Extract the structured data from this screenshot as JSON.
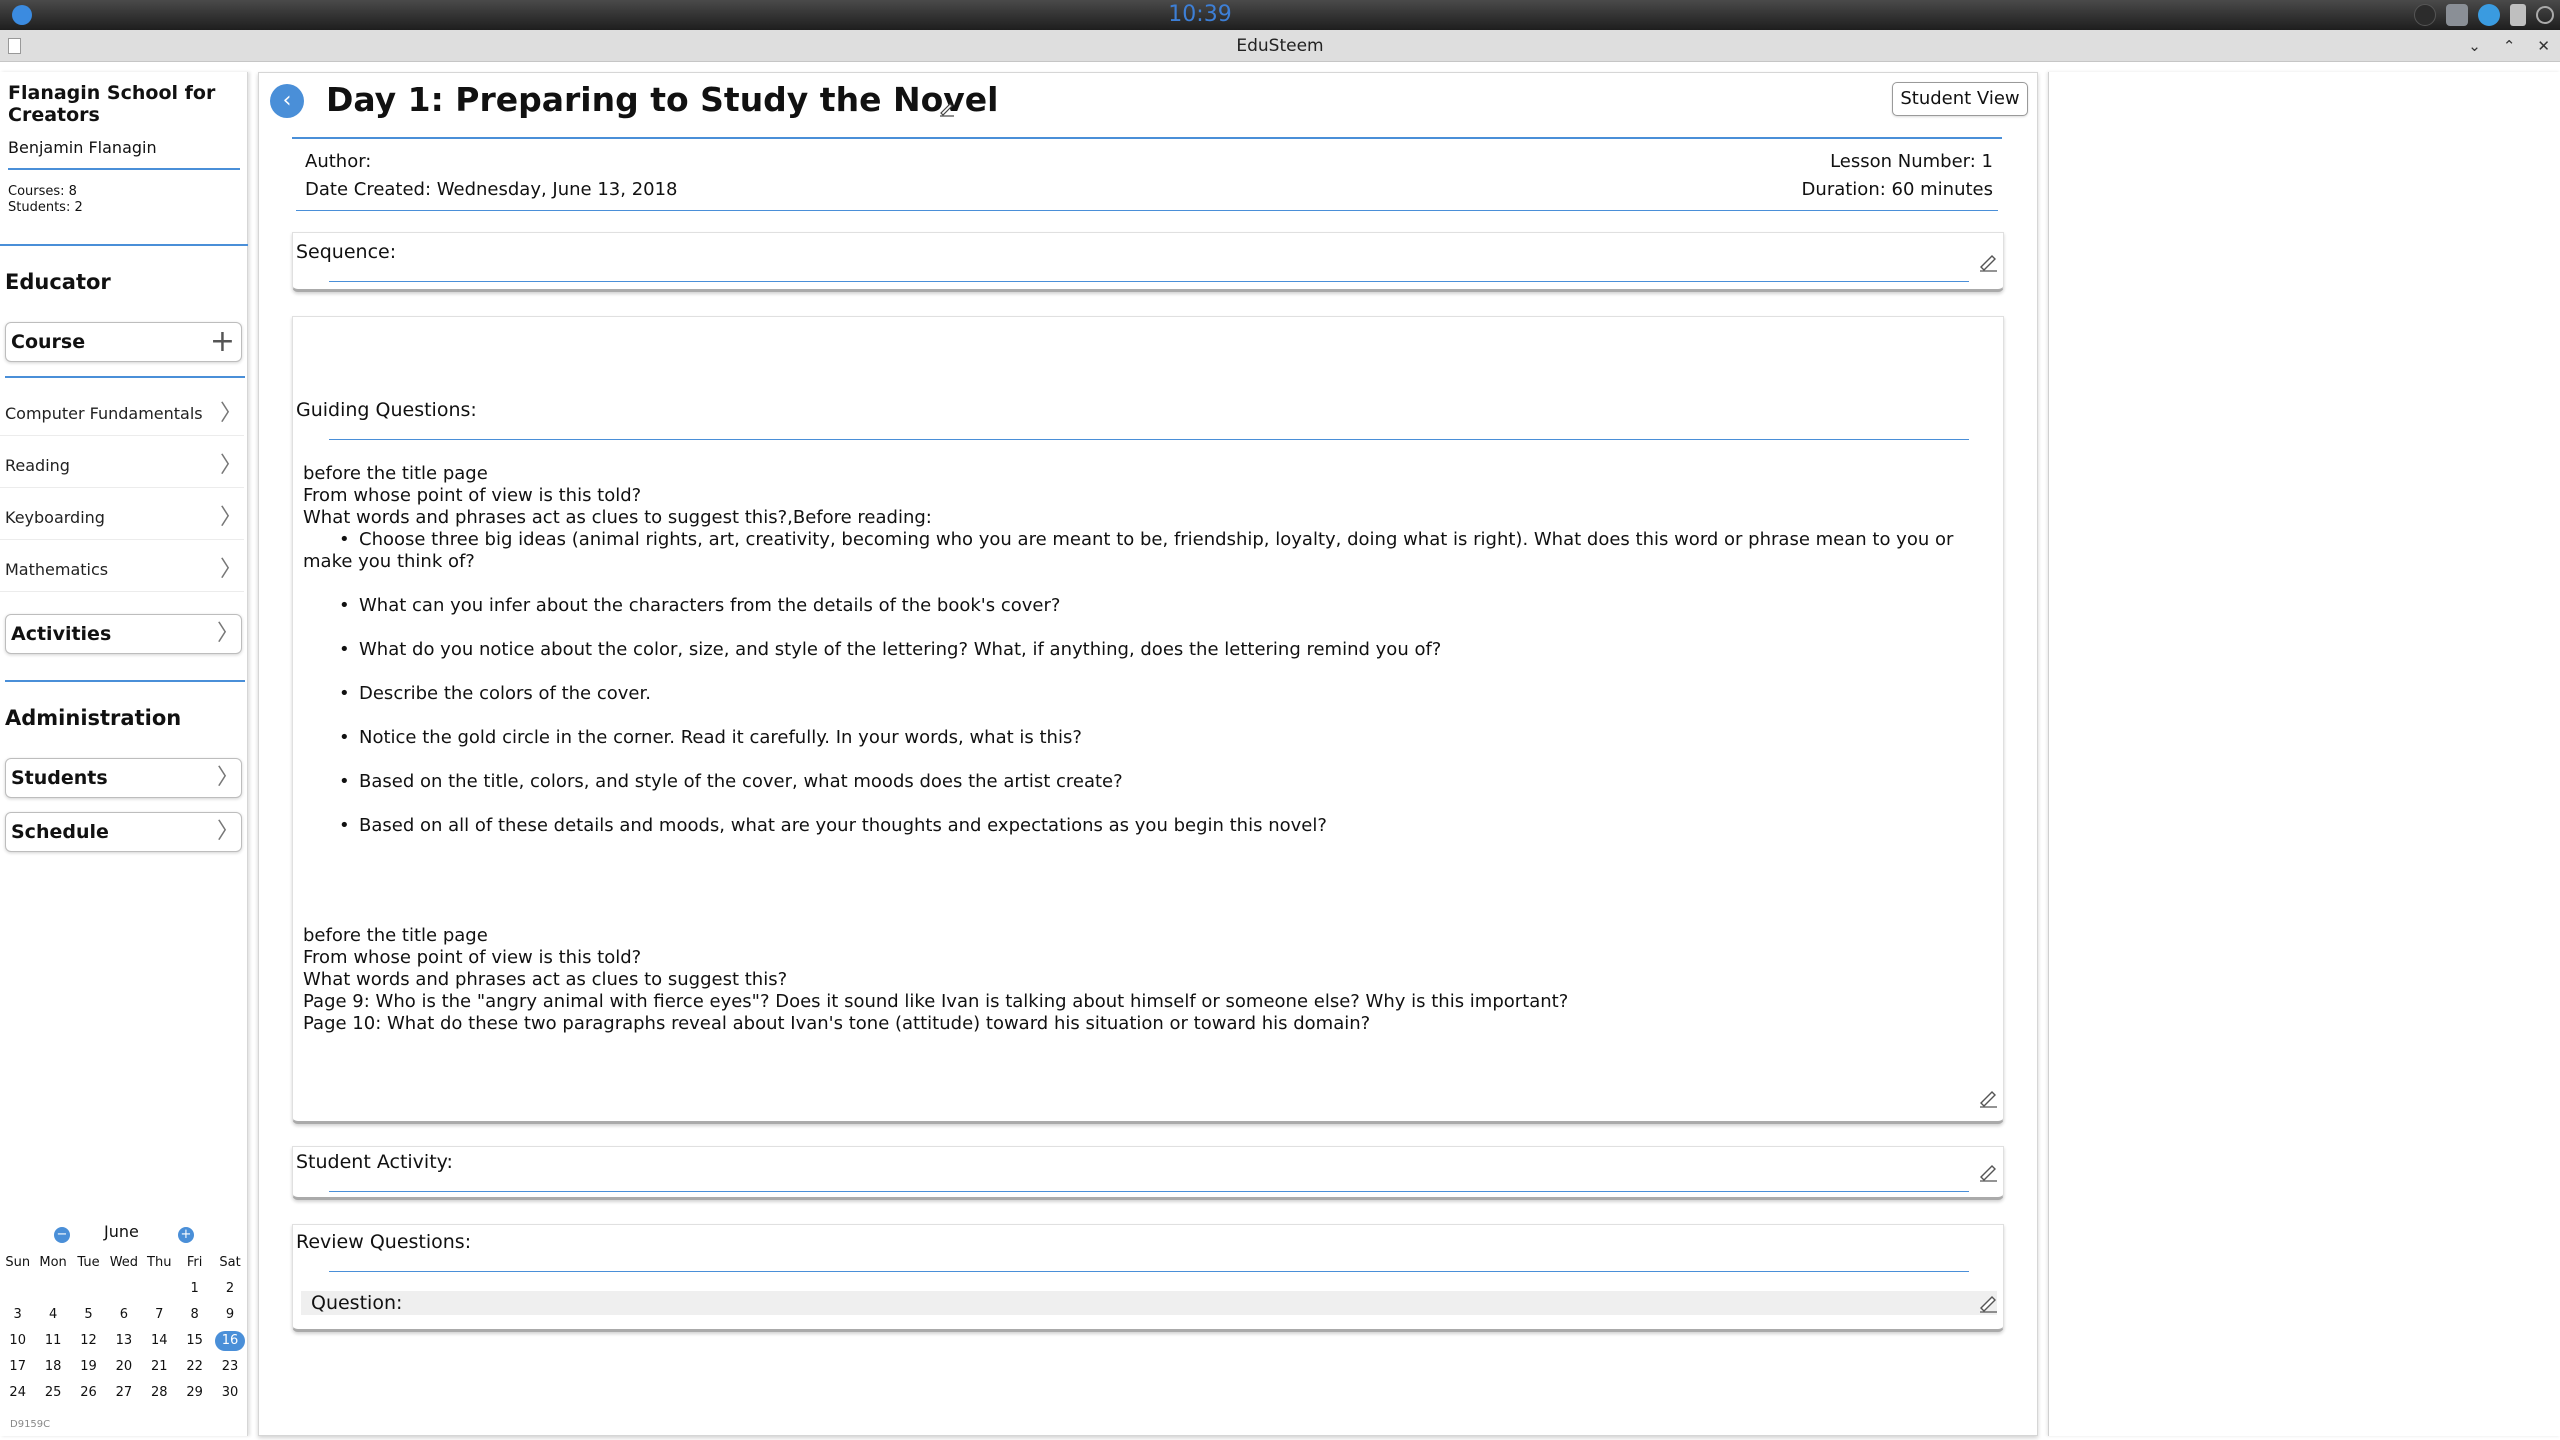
{
  "system": {
    "clock": "10:39"
  },
  "window": {
    "title": "EduSteem"
  },
  "sidebar": {
    "org_name": "Flanagin School for Creators",
    "user_name": "Benjamin Flanagin",
    "courses_stat": "Courses: 8",
    "students_stat": "Students: 2",
    "educator_heading": "Educator",
    "course_button": "Course",
    "courses": [
      {
        "label": "Computer Fundamentals"
      },
      {
        "label": "Reading"
      },
      {
        "label": "Keyboarding"
      },
      {
        "label": "Mathematics"
      }
    ],
    "activities_button": "Activities",
    "admin_heading": "Administration",
    "students_button": "Students",
    "schedule_button": "Schedule",
    "build": "D9159C"
  },
  "calendar": {
    "month": "June",
    "weekdays": [
      "Sun",
      "Mon",
      "Tue",
      "Wed",
      "Thu",
      "Fri",
      "Sat"
    ],
    "weeks": [
      [
        "",
        "",
        "",
        "",
        "",
        "1",
        "2"
      ],
      [
        "3",
        "4",
        "5",
        "6",
        "7",
        "8",
        "9"
      ],
      [
        "10",
        "11",
        "12",
        "13",
        "14",
        "15",
        "16"
      ],
      [
        "17",
        "18",
        "19",
        "20",
        "21",
        "22",
        "23"
      ],
      [
        "24",
        "25",
        "26",
        "27",
        "28",
        "29",
        "30"
      ]
    ],
    "today": "16"
  },
  "lesson": {
    "title": "Day 1: Preparing to Study the Novel",
    "student_view": "Student View",
    "author": "Author:",
    "date_created": "Date Created: Wednesday, June 13, 2018",
    "lesson_number": "Lesson Number: 1",
    "duration": "Duration: 60 minutes",
    "sequence_label": "Sequence:",
    "guiding_label": "Guiding Questions:",
    "guiding_intro": [
      "before the title page",
      "From whose point of view is this told?",
      "What words and phrases act as clues to suggest this?,Before reading:"
    ],
    "guiding_first_bullet": "Choose three big ideas (animal rights, art, creativity, becoming who you are meant to be, friendship, loyalty, doing what is right). What does this word or phrase mean to you or make you think of?",
    "guiding_bullets": [
      "What can you infer about the characters from the details of the book's cover?",
      "What do you notice about the color, size, and style of the lettering? What, if anything, does the lettering remind you of?",
      "Describe the colors of the cover.",
      "Notice the gold circle in the corner. Read it carefully. In your words, what is this?",
      "Based on the title, colors, and style of the cover, what moods does the artist create?",
      "Based on all of these details and moods, what are your thoughts and expectations as you begin this novel?"
    ],
    "guiding_outro": [
      "before the title page",
      "From whose point of view is this told?",
      "What words and phrases act as clues to suggest this?",
      "Page 9: Who is the \"angry animal with fierce eyes\"? Does it sound like Ivan is talking about himself or someone else? Why is this important?",
      "Page 10: What do these two paragraphs reveal about Ivan's tone (attitude) toward his situation or toward his domain?"
    ],
    "student_activity_label": "Student Activity:",
    "review_label": "Review Questions:",
    "question_label": "Question:"
  },
  "colors": {
    "accent": "#4a8fd8"
  }
}
